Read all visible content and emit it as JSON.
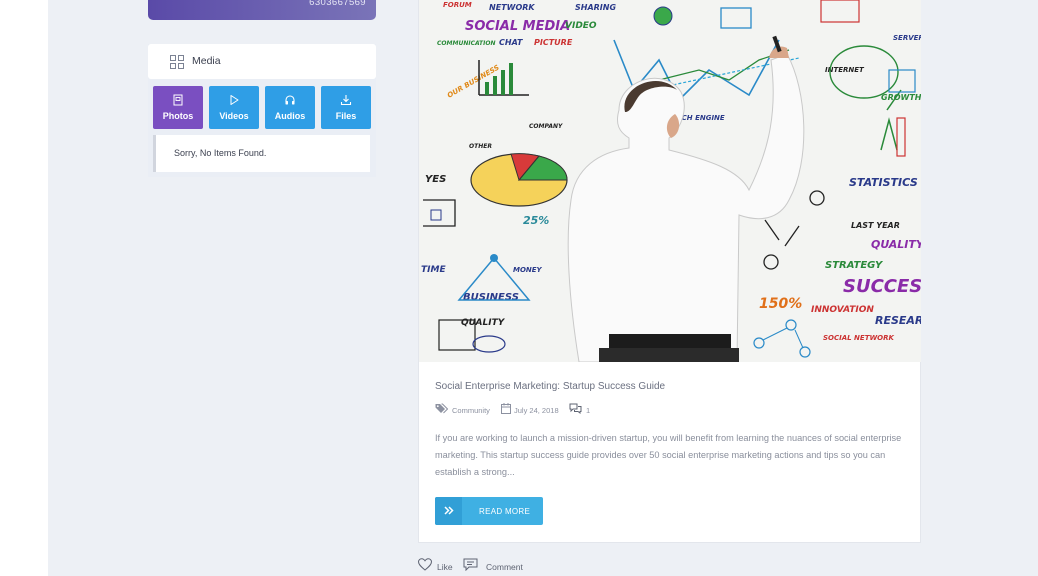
{
  "profile": {
    "number": "6303667569"
  },
  "media": {
    "title": "Media",
    "tabs": [
      {
        "label": "Photos",
        "icon": "photo-icon",
        "active": true
      },
      {
        "label": "Videos",
        "icon": "play-icon"
      },
      {
        "label": "Audios",
        "icon": "headphones-icon"
      },
      {
        "label": "Files",
        "icon": "download-icon"
      }
    ],
    "empty_message": "Sorry, No Items Found."
  },
  "post": {
    "title": "Social Enterprise Marketing: Startup Success Guide",
    "category": "Community",
    "date": "July 24, 2018",
    "comments_count": "1",
    "excerpt": "If you are working to launch a mission-driven startup, you will benefit from learning the nuances of social enterprise marketing. This startup success guide provides over 50 social enterprise marketing actions and tips so you can establish a strong...",
    "read_more_label": "READ MORE",
    "image_words": {
      "w1": "SOCIAL MEDIA",
      "w2": "VIDEO",
      "w3": "NETWORK",
      "w4": "SHARING",
      "w5": "FORUM",
      "w6": "CHAT",
      "w7": "PICTURE",
      "w8": "COMMUNICATION",
      "w9": "OUR BUSINESS",
      "w10": "INTERNET",
      "w11": "GROWTH",
      "w12": "STATISTICS",
      "w13": "LAST YEAR",
      "w14": "QUALITY",
      "w15": "STRATEGY",
      "w16": "SUCCESS",
      "w17": "RESEARCH",
      "w18": "INNOVATION",
      "w19": "150%",
      "w20": "BUSINESS",
      "w21": "QUALITY",
      "w22": "TIME",
      "w23": "MONEY",
      "w24": "YES",
      "w25": "OTHER",
      "w26": "COMPANY",
      "w27": "SOCIAL NETWORK",
      "w28": "SEARCH ENGINE",
      "w29": "SERVER",
      "w30": "25%"
    }
  },
  "actions": {
    "like_label": "Like",
    "comment_label": "Comment"
  },
  "colors": {
    "active_tab": "#7a4fc1",
    "tab": "#2f9ee6",
    "read_more": "#3fb0e3",
    "profile_gradient_start": "#5a4aa8"
  }
}
